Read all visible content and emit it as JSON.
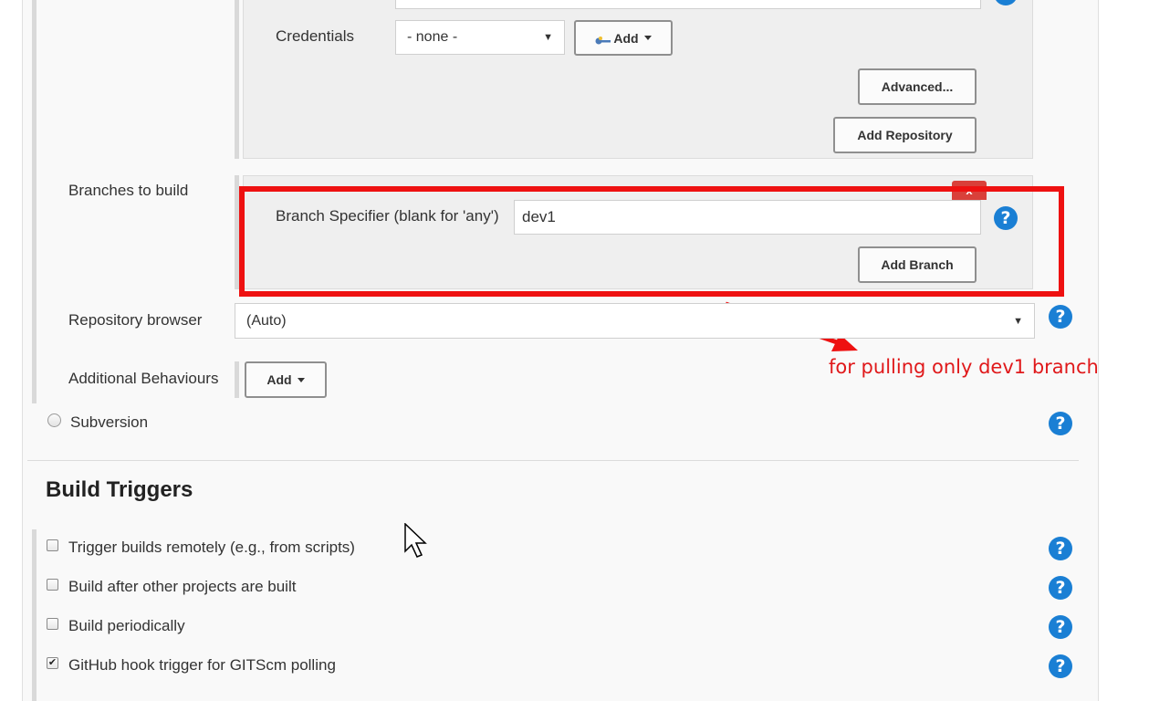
{
  "scm": {
    "credentials": {
      "label": "Credentials",
      "select_value": "- none -",
      "add_button": "Add"
    },
    "advanced_button": "Advanced...",
    "add_repository_button": "Add Repository",
    "branches": {
      "section_label": "Branches to build",
      "delete_button": "x",
      "specifier_label": "Branch Specifier (blank for 'any')",
      "specifier_value": "dev1",
      "add_branch_button": "Add Branch"
    },
    "repository_browser": {
      "label": "Repository browser",
      "value": "(Auto)"
    },
    "additional_behaviours": {
      "label": "Additional Behaviours",
      "add_button": "Add"
    },
    "subversion_label": "Subversion"
  },
  "annotation": {
    "text": "for pulling only dev1 branch",
    "color": "#e0191b"
  },
  "build_triggers": {
    "title": "Build Triggers",
    "items": [
      {
        "label": "Trigger builds remotely (e.g., from scripts)",
        "checked": false
      },
      {
        "label": "Build after other projects are built",
        "checked": false
      },
      {
        "label": "Build periodically",
        "checked": false
      },
      {
        "label": "GitHub hook trigger for GITScm polling",
        "checked": true
      }
    ]
  },
  "colors": {
    "help_icon": "#1a7fd4",
    "highlight_border": "#ee1111",
    "delete_button": "#d9403a"
  }
}
